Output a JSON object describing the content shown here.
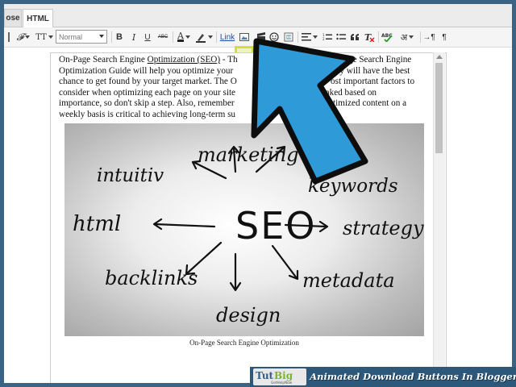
{
  "tabs": [
    {
      "label": "ose"
    },
    {
      "label": "HTML"
    }
  ],
  "toolbar": {
    "font_size_icon": "𝓕",
    "text_size_icon": "TT",
    "font_value": "Normal",
    "bold": "B",
    "italic": "I",
    "underline": "U",
    "strike": "ABC",
    "text_color": "A",
    "link": "Link",
    "hindi_char": "अ",
    "para_mark": "¶"
  },
  "editor": {
    "text_before_link": "On-Page Search Engine ",
    "link_text": "Optimization (SEO)",
    "line1_rest": " - Th",
    "line1_end": "o On-Page Search Engine",
    "line2_start": "Optimization Guide will help you optimize your",
    "line2_end": "so they will have the best",
    "line3_start": "chance to get found by your target market. The O",
    "line3_end": "ost important factors to",
    "line4_start": "consider when optimizing each page on your site",
    "line4_end": "nked based on",
    "line5_start": "importance, so don't skip a step. Also, remember",
    "line5_end": "ew optimized content on a",
    "line6_start": "weekly basis is critical to achieving long-term su",
    "caption": "On-Page Search Engine Optimization"
  },
  "seo_image": {
    "center": "SEO",
    "words": [
      "intuitiv",
      "marketing",
      "keywords",
      "html",
      "strategy",
      "backlinks",
      "metadata",
      "design"
    ]
  },
  "banner": {
    "logo_text": "TutBig",
    "logo_sub": "GetHelpNow",
    "title": "Animated Download Buttons In Blogger"
  },
  "colors": {
    "page_bg": "#3a6384",
    "highlight": "#d3df3b",
    "arrow_fill": "#2f9ad8",
    "link_color": "#1a4fb0",
    "banner_bg": "#2e5879"
  }
}
